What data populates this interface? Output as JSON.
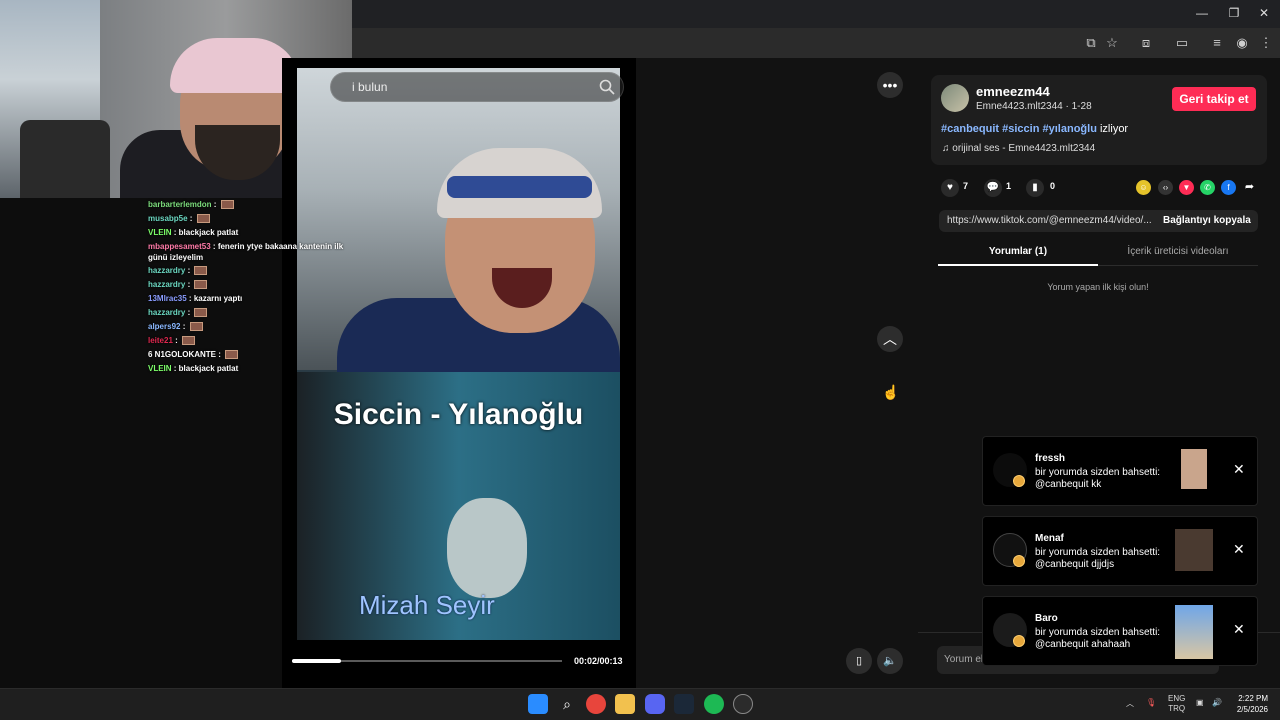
{
  "window": {
    "minimize": "—",
    "restore": "❐",
    "close": "✕"
  },
  "chat": [
    {
      "user": "barbarterlemdon",
      "color": "#7cdc7c",
      "msg": "",
      "emote": true
    },
    {
      "user": "musabp5e",
      "color": "#6bd6c0",
      "msg": "",
      "emote": true
    },
    {
      "user": "VLEIN",
      "color": "#7dff6a",
      "msg": "blackjack patlat",
      "emote": false
    },
    {
      "user": "mbappesamet53",
      "color": "#ff7aa8",
      "msg": "fenerin ytye bakaana kantenin ilk günü izleyelim",
      "emote": false,
      "wrap": true
    },
    {
      "user": "hazzardry",
      "color": "#6bd6c0",
      "msg": "",
      "emote": true
    },
    {
      "user": "hazzardry",
      "color": "#6bd6c0",
      "msg": "",
      "emote": true
    },
    {
      "user": "13Mlrac35",
      "color": "#8a9cff",
      "msg": "kazarnı yaptı",
      "emote": false
    },
    {
      "user": "hazzardry",
      "color": "#6bd6c0",
      "msg": "",
      "emote": true
    },
    {
      "user": "alpers92",
      "color": "#8ab8ff",
      "msg": "",
      "emote": true
    },
    {
      "user": "leite21",
      "color": "#e0284f",
      "msg": "",
      "emote": true
    },
    {
      "user": "N1GOLOKANTE",
      "color": "#ffffff",
      "msg": "",
      "emote": true,
      "prefix": "6"
    },
    {
      "user": "VLEIN",
      "color": "#7dff6a",
      "msg": "blackjack patlat",
      "emote": false
    }
  ],
  "video": {
    "search_placeholder": "i bulun",
    "title_overlay": "Siccin - Yılanoğlu",
    "watermark": "Mizah Seyir",
    "time": "00:02/00:13",
    "progress": 0.18
  },
  "creator": {
    "username": "emneezm44",
    "handle_line": "Emne4423.mlt2344 · 1-28",
    "follow_label": "Geri takip et",
    "tags": [
      "#canbequit",
      "#siccin",
      "#yılanoğlu"
    ],
    "tags_suffix": "izliyor",
    "music": "orijinal ses - Emne4423.mlt2344"
  },
  "stats": {
    "likes": "7",
    "comments": "1",
    "saves": "0"
  },
  "share": {
    "url": "https://www.tiktok.com/@emneezm44/video/...",
    "copy_label": "Bağlantıyı kopyala"
  },
  "tabs": {
    "comments": "Yorumlar (1)",
    "creator_videos": "İçerik üreticisi videoları"
  },
  "empty_comments": "Yorum yapan ilk kişi olun!",
  "comment_placeholder": "Yorum ek",
  "notifications": [
    {
      "name": "fressh",
      "text": "bir yorumda sizden bahsetti: @canbequit kk"
    },
    {
      "name": "Menaf",
      "text": "bir yorumda sizden bahsetti: @canbequit djjdjs"
    },
    {
      "name": "Baro",
      "text": "bir yorumda sizden bahsetti: @canbequit ahahaah"
    }
  ],
  "tray": {
    "lang1": "ENG",
    "lang2": "TRQ",
    "time": "2:22 PM",
    "date": "2/5/2026"
  },
  "colors": {
    "accent": "#fe2c55",
    "tag": "#8ab8ff"
  }
}
